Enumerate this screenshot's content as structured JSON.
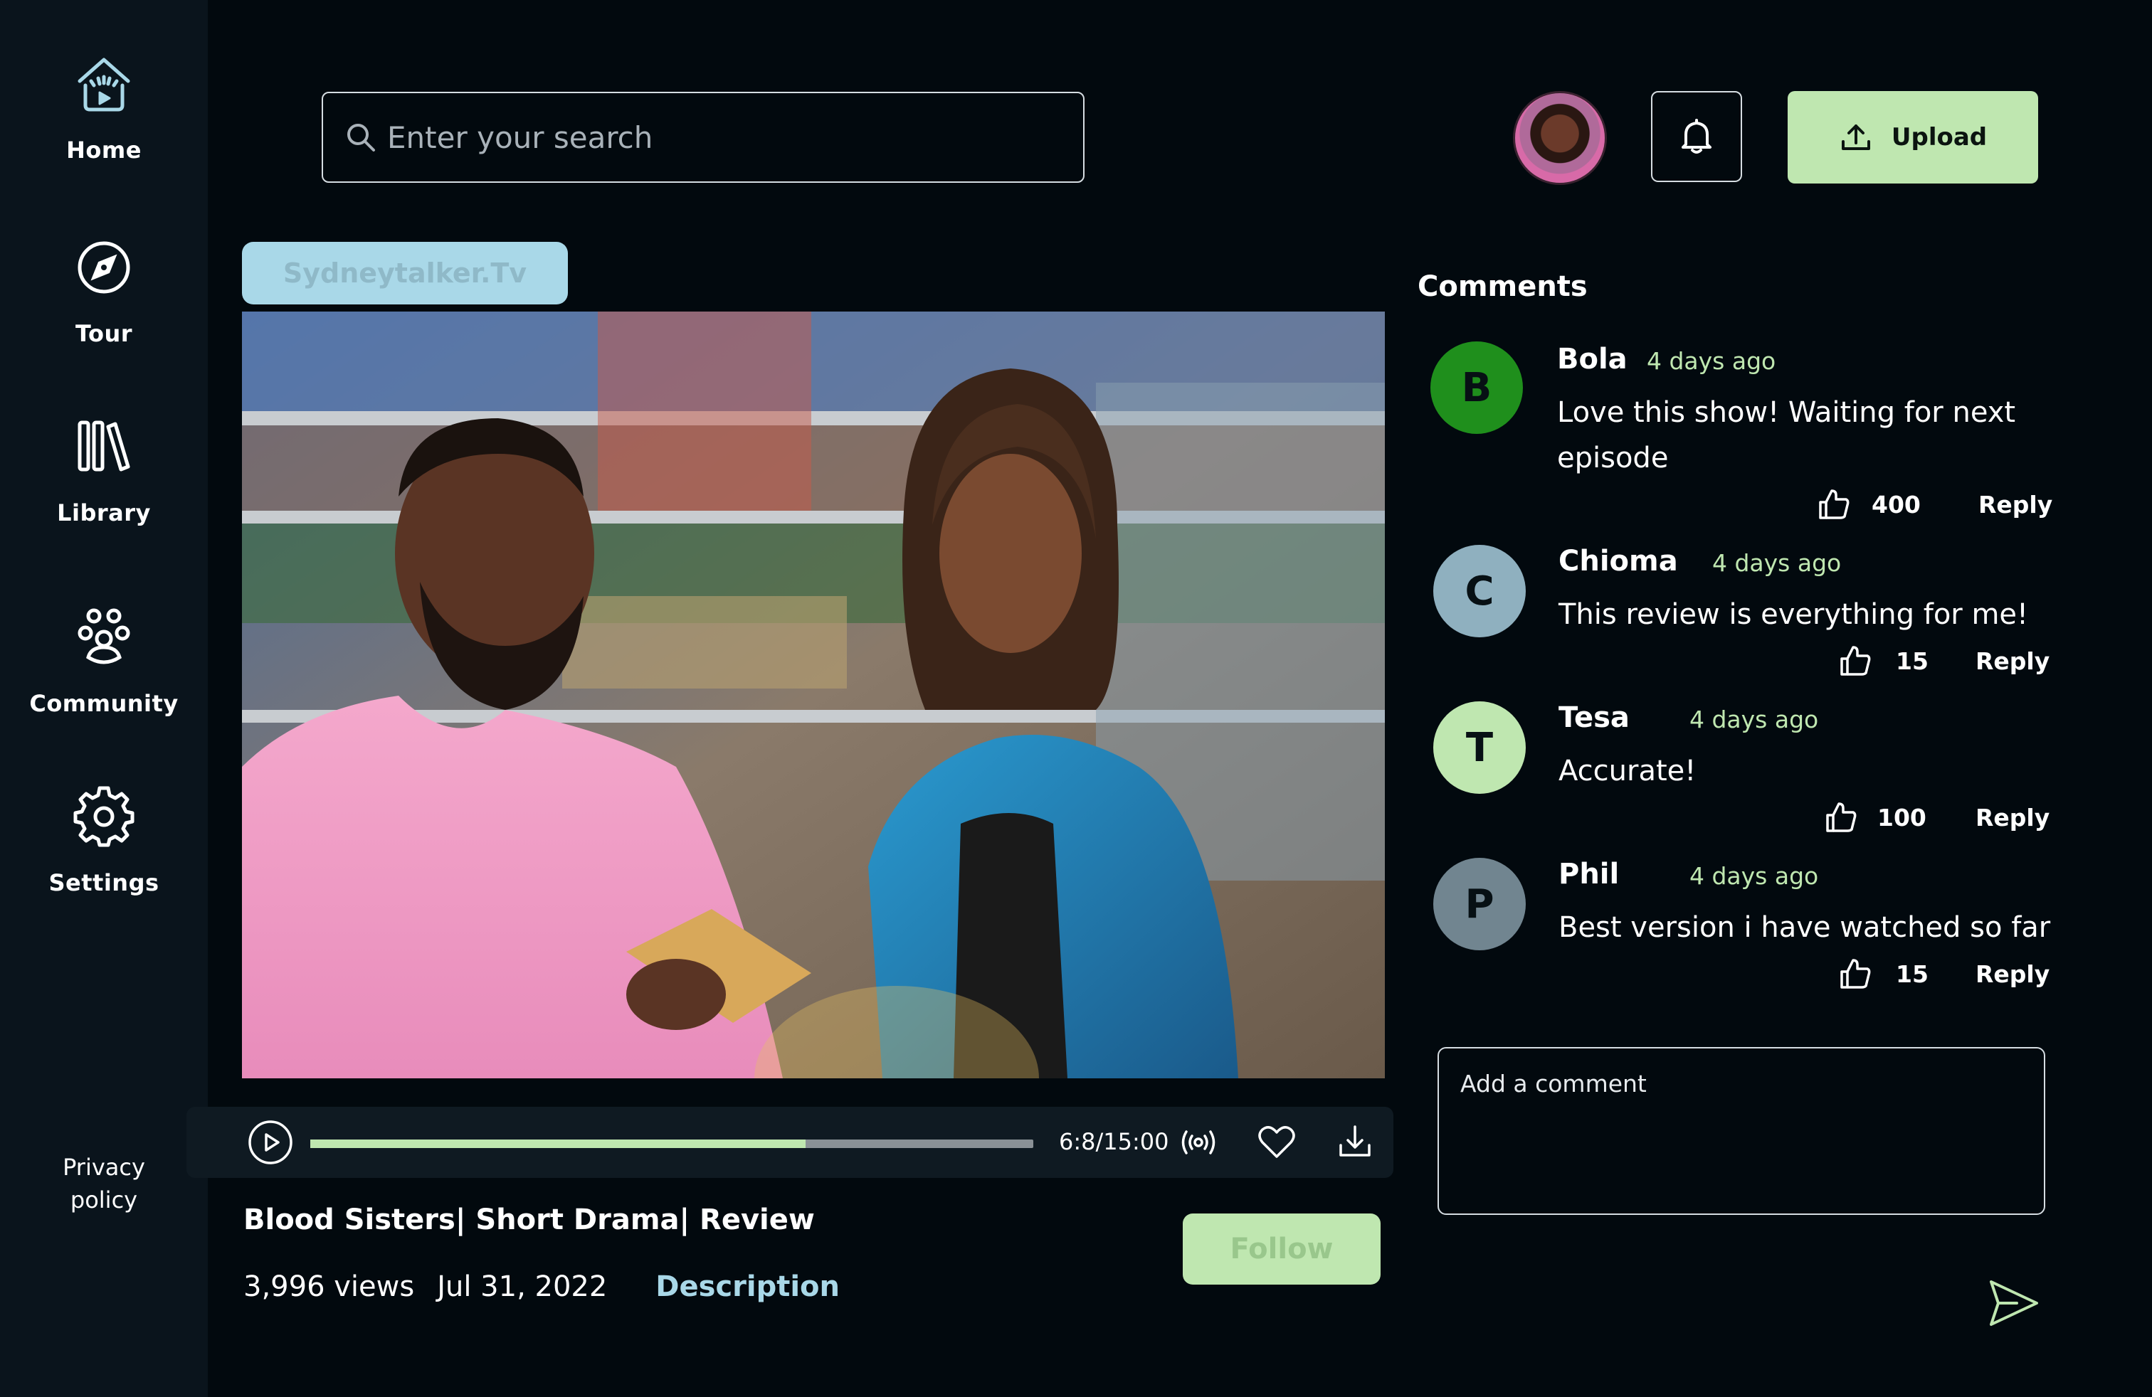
{
  "sidebar": {
    "items": [
      {
        "label": "Home",
        "icon": "home-play-icon"
      },
      {
        "label": "Tour",
        "icon": "compass-icon"
      },
      {
        "label": "Library",
        "icon": "library-icon"
      },
      {
        "label": "Community",
        "icon": "community-icon"
      },
      {
        "label": "Settings",
        "icon": "gear-icon"
      }
    ],
    "privacy_label_1": "Privacy",
    "privacy_label_2": "policy"
  },
  "header": {
    "search_placeholder": "Enter your search",
    "upload_label": "Upload"
  },
  "video": {
    "channel": "Sydneytalker.Tv",
    "title": "Blood Sisters| Short Drama| Review",
    "views": "3,996 views",
    "date": "Jul 31, 2022",
    "description_label": "Description",
    "follow_label": "Follow",
    "time": "6:8/15:00",
    "progress_fraction": 0.685
  },
  "comments": {
    "title": "Comments",
    "items": [
      {
        "initial": "B",
        "name": "Bola",
        "time": "4 days ago",
        "text": "Love this show! Waiting for next episode",
        "likes": "400",
        "reply": "Reply",
        "color": "#1f8f1c"
      },
      {
        "initial": "C",
        "name": "Chioma",
        "time": "4 days ago",
        "text": "This review is everything for me!",
        "likes": "15",
        "reply": "Reply",
        "color": "#8fb0bf"
      },
      {
        "initial": "T",
        "name": "Tesa",
        "time": "4 days ago",
        "text": "Accurate!",
        "likes": "100",
        "reply": "Reply",
        "color": "#bfe7b0"
      },
      {
        "initial": "P",
        "name": "Phil",
        "time": "4 days ago",
        "text": "Best version i have watched so far",
        "likes": "15",
        "reply": "Reply",
        "color": "#718590"
      }
    ],
    "add_placeholder": "Add a comment"
  },
  "colors": {
    "background": "#02090e",
    "sidebar": "#0a141c",
    "accent_green": "#bfe7b0",
    "accent_blue": "#a9d8e8"
  }
}
